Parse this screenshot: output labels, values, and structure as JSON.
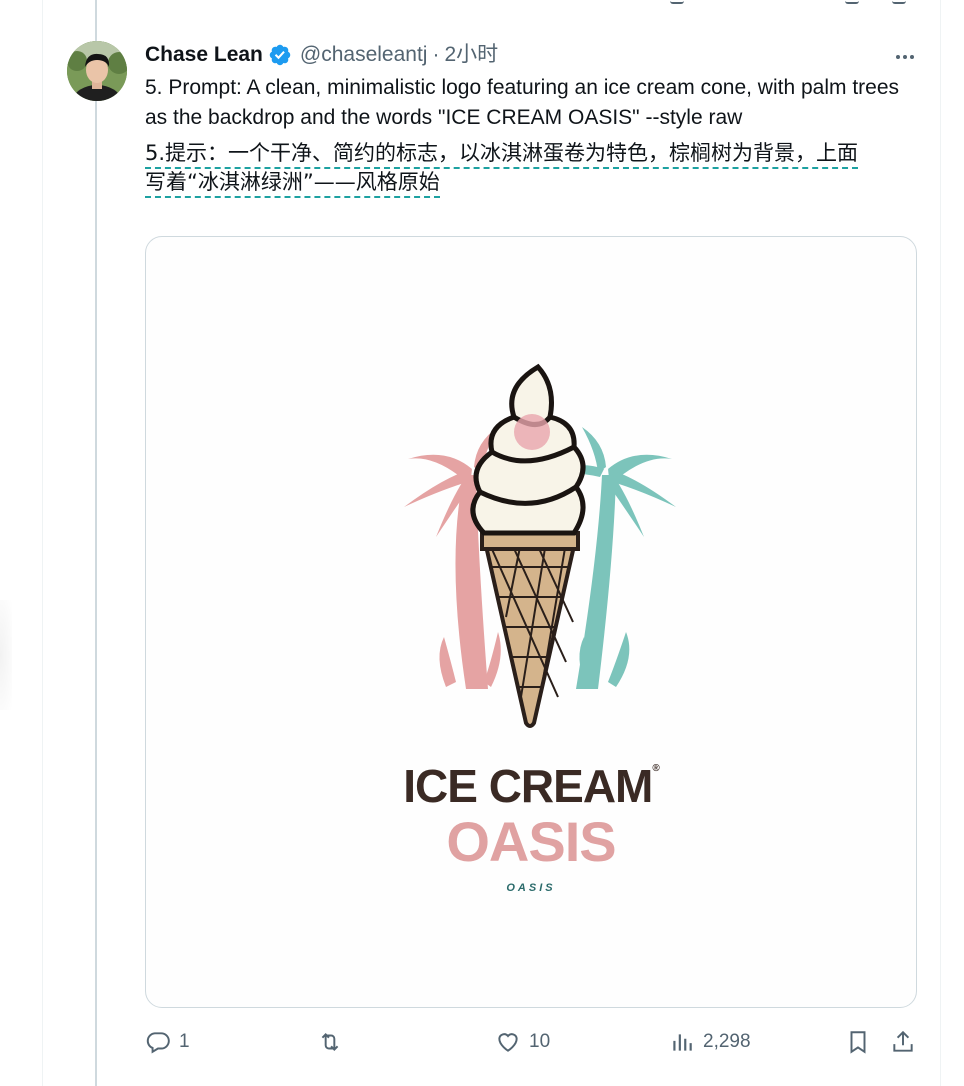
{
  "author": {
    "name": "Chase Lean",
    "handle": "@chaseleantj",
    "separator": "·",
    "time": "2小时"
  },
  "tweet": {
    "text_en": "5. Prompt: A clean, minimalistic logo featuring an ice cream cone, with palm trees as the backdrop and the words \"ICE CREAM OASIS\" --style raw",
    "text_zh_line1": "5.提示：一个干净、简约的标志，以冰淇淋蛋卷为特色，棕榈树为背景，上面",
    "text_zh_line2": "写着“冰淇淋绿洲”——风格原始"
  },
  "media": {
    "logo_line1": "ICE CREAM",
    "logo_reg": "®",
    "logo_line2": "OASIS",
    "logo_line3": "OASIS"
  },
  "actions": {
    "reply_count": "1",
    "like_count": "10",
    "views_count": "2,298"
  },
  "icons": {
    "verified": "verified-badge-icon",
    "more": "more-icon",
    "reply": "reply-icon",
    "retweet": "retweet-icon",
    "like": "heart-icon",
    "views": "views-icon",
    "bookmark": "bookmark-icon",
    "share": "share-icon"
  },
  "colors": {
    "verified": "#1d9bf0",
    "text_secondary": "#536471",
    "palm_left": "#e5a3a3",
    "palm_right": "#7cc4bb",
    "translation_underline": "#1da1a1"
  }
}
